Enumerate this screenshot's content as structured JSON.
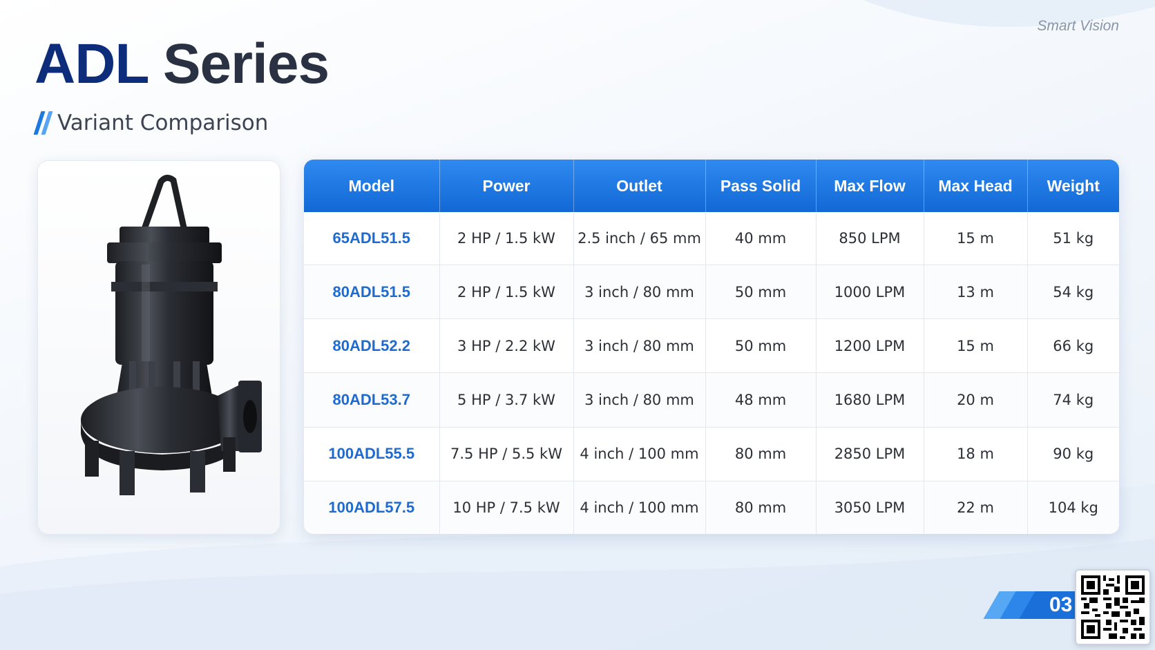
{
  "brand": "Smart Vision",
  "title": {
    "part1": "ADL",
    "part2": "Series"
  },
  "subtitle": "Variant Comparison",
  "product_image": {
    "icon": "submersible-pump-image"
  },
  "table": {
    "headers": [
      "Model",
      "Power",
      "Outlet",
      "Pass Solid",
      "Max Flow",
      "Max Head",
      "Weight"
    ],
    "rows": [
      [
        "65ADL51.5",
        "2 HP / 1.5 kW",
        "2.5 inch / 65 mm",
        "40 mm",
        "850 LPM",
        "15 m",
        "51 kg"
      ],
      [
        "80ADL51.5",
        "2 HP / 1.5 kW",
        "3 inch / 80 mm",
        "50 mm",
        "1000 LPM",
        "13 m",
        "54 kg"
      ],
      [
        "80ADL52.2",
        "3 HP / 2.2 kW",
        "3 inch / 80 mm",
        "50 mm",
        "1200 LPM",
        "15 m",
        "66 kg"
      ],
      [
        "80ADL53.7",
        "5 HP / 3.7 kW",
        "3 inch / 80 mm",
        "48 mm",
        "1680 LPM",
        "20 m",
        "74 kg"
      ],
      [
        "100ADL55.5",
        "7.5 HP / 5.5 kW",
        "4 inch / 100 mm",
        "80 mm",
        "2850 LPM",
        "18 m",
        "90 kg"
      ],
      [
        "100ADL57.5",
        "10 HP / 7.5 kW",
        "4 inch / 100 mm",
        "80 mm",
        "3050 LPM",
        "22 m",
        "104 kg"
      ]
    ]
  },
  "page_number": "03",
  "qr_code": {
    "icon": "qr-code-icon"
  },
  "colors": {
    "accent": "#1a6fd8",
    "header_bg": "#1f78e4",
    "title_dark": "#0d2c7a",
    "model_text": "#1e6ad1"
  }
}
